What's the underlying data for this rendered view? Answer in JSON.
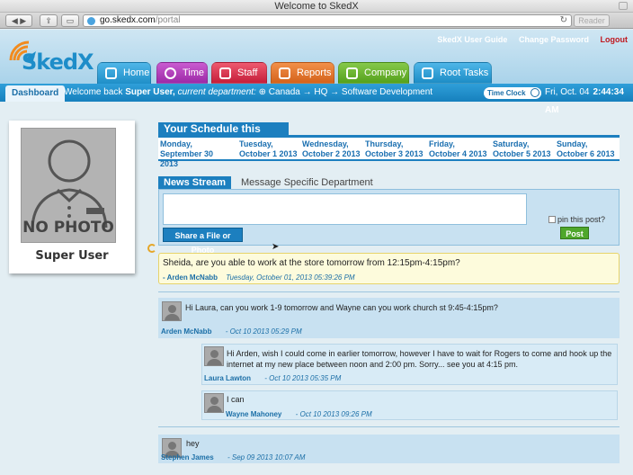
{
  "browser": {
    "window_title": "Welcome to SkedX",
    "url_domain": "go.skedx.com",
    "url_path": "/portal",
    "reader_label": "Reader"
  },
  "header": {
    "logo_text": "SkedX",
    "links": {
      "guide": "SkedX User Guide",
      "change_password": "Change Password",
      "logout": "Logout"
    },
    "tabs": [
      {
        "label": "Home"
      },
      {
        "label": "Time"
      },
      {
        "label": "Staff"
      },
      {
        "label": "Reports"
      },
      {
        "label": "Company"
      },
      {
        "label": "Root Tasks"
      }
    ]
  },
  "navbar": {
    "dashboard": "Dashboard",
    "welcome_prefix": "Welcome back",
    "user": "Super User,",
    "dept_label": "current department:",
    "dept_path": "Canada → HQ → Software Development",
    "time_clock": "Time Clock",
    "date": "Fri, Oct. 04",
    "time": "2:44:34 AM"
  },
  "profile": {
    "no_photo": "NO PHOTO",
    "name": "Super User"
  },
  "schedule": {
    "title": "Your Schedule this Week",
    "days": [
      {
        "name": "Monday,",
        "date": "September 30 2013"
      },
      {
        "name": "Tuesday,",
        "date": "October 1 2013"
      },
      {
        "name": "Wednesday,",
        "date": "October 2 2013"
      },
      {
        "name": "Thursday,",
        "date": "October 3 2013"
      },
      {
        "name": "Friday,",
        "date": "October 4 2013"
      },
      {
        "name": "Saturday,",
        "date": "October 5 2013"
      },
      {
        "name": "Sunday,",
        "date": "October 6 2013"
      }
    ]
  },
  "stream": {
    "tab_news": "News Stream",
    "tab_message": "Message Specific Department",
    "share_label": "Share a File or Photo",
    "pin_label": "pin this post?",
    "post_label": "Post",
    "pinned": {
      "text": "Sheida,  are you able to work at the store tomorrow from 12:15pm-4:15pm?",
      "author": "- Arden McNabb",
      "stamp": "Tuesday, October 01, 2013 05:39:26 PM"
    },
    "posts": [
      {
        "text": "Hi Laura, can you work 1-9 tomorrow and Wayne can you work church st 9:45-4:15pm?",
        "author": "Arden McNabb",
        "stamp": "- Oct 10 2013 05:29 PM",
        "replies": [
          {
            "text": "Hi Arden, wish I could come in earlier tomorrow, however I have to wait for Rogers to come and hook up the internet at my new place between noon and 2:00 pm. Sorry... see you at 4:15 pm.",
            "author": "Laura Lawton",
            "stamp": "- Oct 10 2013 05:35 PM"
          },
          {
            "text": "I can",
            "author": "Wayne Mahoney",
            "stamp": "- Oct 10 2013 09:26 PM"
          }
        ]
      },
      {
        "text": "hey",
        "author": "Stephen James",
        "stamp": "- Sep 09 2013 10:07 AM"
      }
    ]
  }
}
